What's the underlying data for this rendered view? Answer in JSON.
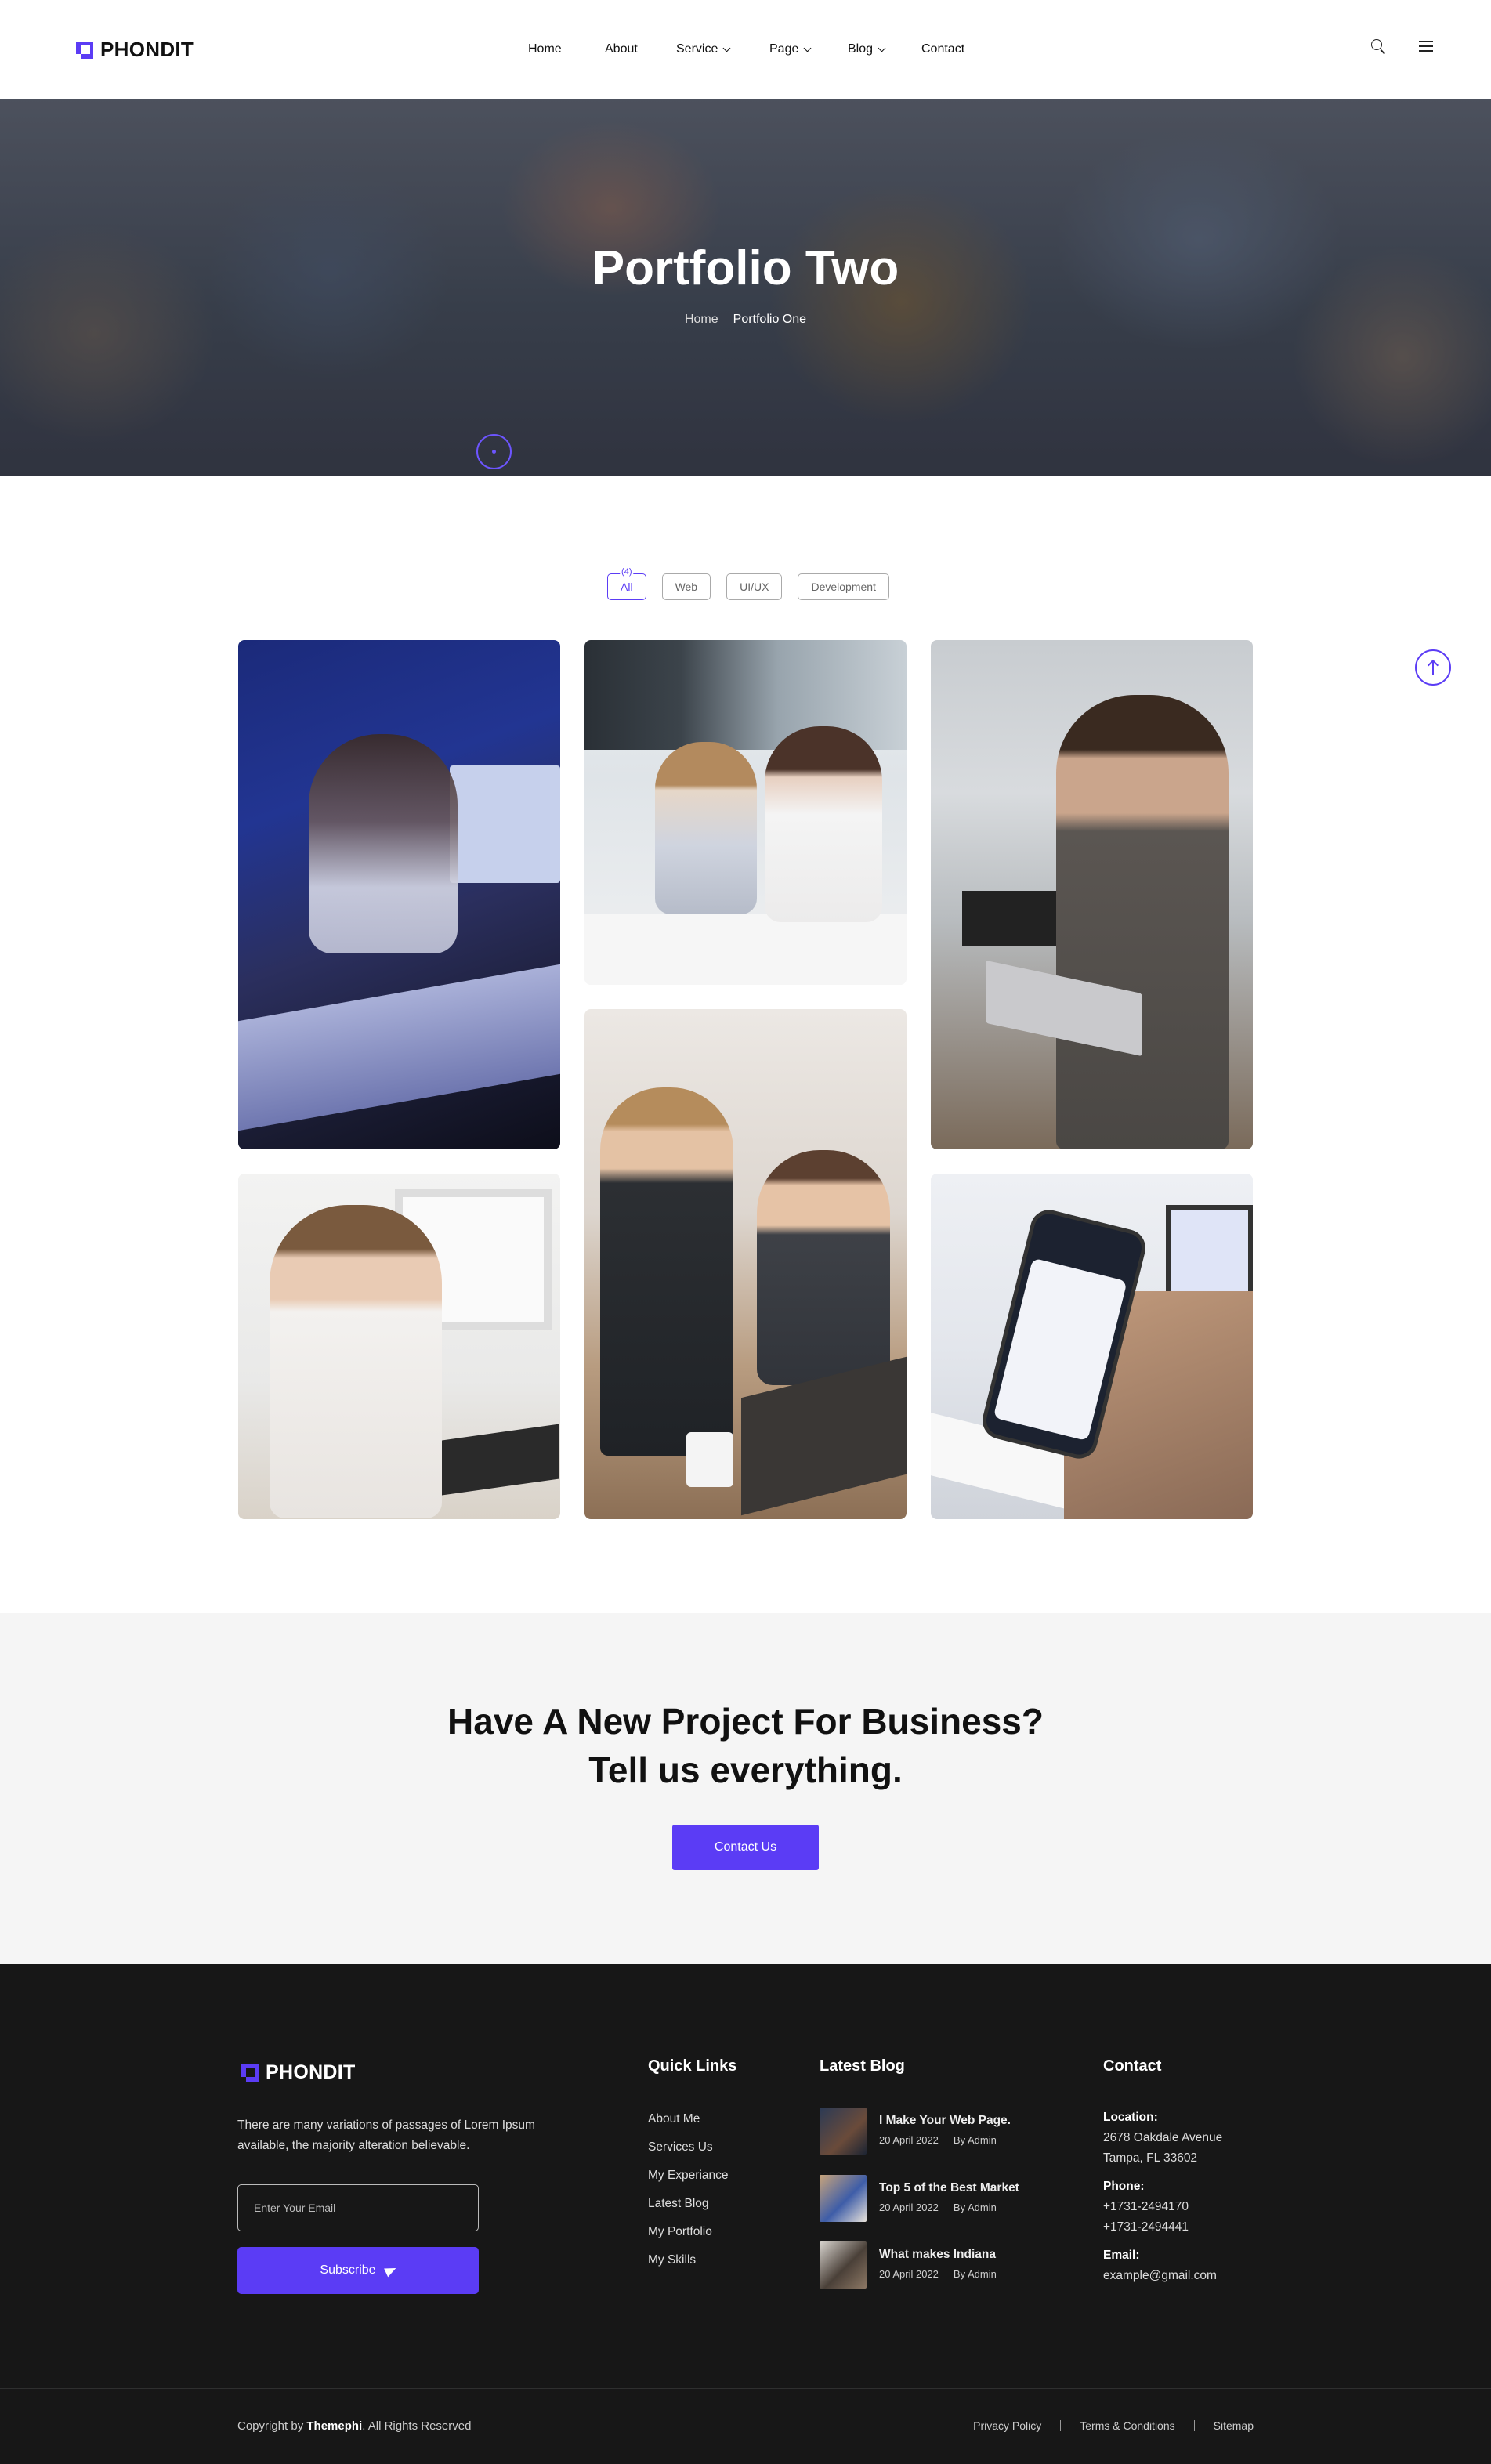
{
  "brand": {
    "name": "PHONDIT",
    "accent": "#5b3cf5"
  },
  "nav": {
    "items": [
      {
        "label": "Home",
        "dropdown": false
      },
      {
        "label": "About",
        "dropdown": false
      },
      {
        "label": "Service",
        "dropdown": true
      },
      {
        "label": "Page",
        "dropdown": true
      },
      {
        "label": "Blog",
        "dropdown": true
      },
      {
        "label": "Contact",
        "dropdown": false
      }
    ],
    "icons": [
      "search-icon",
      "menu-icon"
    ]
  },
  "hero": {
    "title": "Portfolio Two",
    "breadcrumb": {
      "home": "Home",
      "current": "Portfolio One"
    }
  },
  "filters": {
    "items": [
      {
        "label": "All",
        "count": "(4)",
        "active": true
      },
      {
        "label": "Web",
        "active": false
      },
      {
        "label": "UI/UX",
        "active": false
      },
      {
        "label": "Development",
        "active": false
      }
    ]
  },
  "gallery": [
    "portfolio-image-1",
    "portfolio-image-2",
    "portfolio-image-3",
    "portfolio-image-4",
    "portfolio-image-5",
    "portfolio-image-6"
  ],
  "cta": {
    "line1": "Have A New Project For Business?",
    "line2": "Tell us everything.",
    "button": "Contact Us"
  },
  "footer": {
    "brand": "PHONDIT",
    "description": "There are many variations of passages of Lorem Ipsum available, the majority alteration believable.",
    "email_placeholder": "Enter Your Email",
    "subscribe_label": "Subscribe",
    "quick_links": {
      "heading": "Quick Links",
      "items": [
        "About Me",
        "Services Us",
        "My Experiance",
        "Latest Blog",
        "My Portfolio",
        "My Skills"
      ]
    },
    "latest_blog": {
      "heading": "Latest Blog",
      "posts": [
        {
          "title": "I Make Your Web Page.",
          "date": "20 April 2022",
          "author": "By Admin"
        },
        {
          "title": "Top 5 of the Best Market",
          "date": "20 April 2022",
          "author": "By Admin"
        },
        {
          "title": "What makes Indiana",
          "date": "20 April 2022",
          "author": "By Admin"
        }
      ]
    },
    "contact": {
      "heading": "Contact",
      "location_label": "Location:",
      "location_line1": "2678 Oakdale Avenue",
      "location_line2": "Tampa, FL 33602",
      "phone_label": "Phone:",
      "phone1": "+1731-2494170",
      "phone2": "+1731-2494441",
      "email_label": "Email:",
      "email": "example@gmail.com"
    },
    "copyright_prefix": "Copyright by ",
    "copyright_brand": "Themephi",
    "copyright_suffix": ". All Rights Reserved",
    "legal": [
      "Privacy Policy",
      "Terms & Conditions",
      "Sitemap"
    ]
  }
}
